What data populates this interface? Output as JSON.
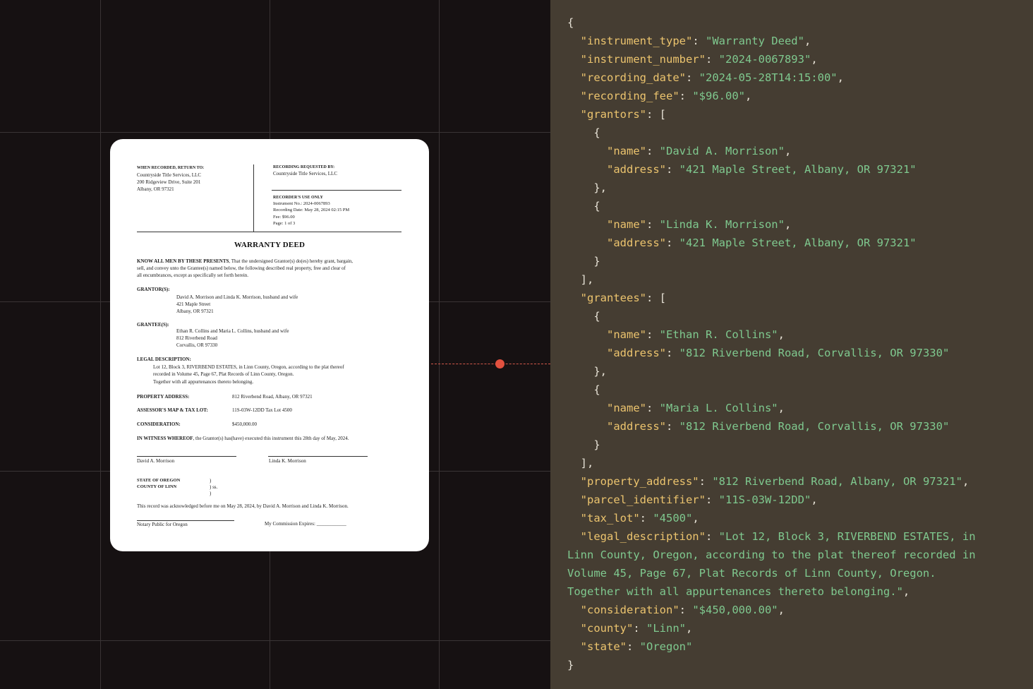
{
  "document": {
    "return_to_heading": "WHEN RECORDED, RETURN TO:",
    "return_to_lines": [
      "Countryside Title Services, LLC",
      "200 Ridgeview Drive, Suite 201",
      "Albany, OR 97321"
    ],
    "requested_by_heading": "RECORDING REQUESTED BY:",
    "requested_by_name": "Countryside Title Services, LLC",
    "recorder_heading": "RECORDER'S USE ONLY",
    "recorder_lines": [
      "Instrument No.:  2024-0067893",
      "Recording Date:  May 28, 2024  02:15 PM",
      "Fee:  $96.00",
      "Page:  1 of 3"
    ],
    "title": "WARRANTY DEED",
    "intro_lead": "KNOW ALL MEN BY THESE PRESENTS",
    "intro_lines": [
      ", That the undersigned Grantor(s) do(es) hereby grant, bargain,",
      "sell, and convey unto the Grantee(s) named below, the following described real property, free and clear of",
      "all encumbrances, except as specifically set forth herein."
    ],
    "grantor_heading": "GRANTOR(S):",
    "grantor_lines": [
      "David A. Morrison and Linda K. Morrison, husband and wife",
      "421 Maple Street",
      "Albany, OR 97321"
    ],
    "grantee_heading": "GRANTEE(S):",
    "grantee_lines": [
      "Ethan R. Collins and Maria L. Collins, husband and wife",
      "812 Riverbend Road",
      "Corvallis, OR 97330"
    ],
    "legal_heading": "LEGAL DESCRIPTION:",
    "legal_lines": [
      "Lot 12, Block 3, RIVERBEND ESTATES, in Linn County, Oregon, according to the plat thereof",
      "recorded in Volume 45, Page 67, Plat Records of Linn County, Oregon.",
      "Together with all appurtenances thereto belonging."
    ],
    "property_label": "PROPERTY ADDRESS:",
    "property_value": "812 Riverbend Road, Albany, OR 97321",
    "assessor_label": "ASSESSOR'S MAP & TAX LOT:",
    "assessor_value": "11S-03W-12DD   Tax Lot 4500",
    "consideration_label": "CONSIDERATION:",
    "consideration_value": "$450,000.00",
    "witness_lead": "IN WITNESS WHEREOF",
    "witness_text": ", the Grantor(s) has(have) executed this instrument this 28th day of May, 2024.",
    "signer_1": "David A. Morrison",
    "signer_2": "Linda K. Morrison",
    "state_line": "STATE OF OREGON",
    "county_line": "COUNTY OF LINN",
    "paren_1": ")",
    "paren_2": ")  ss.",
    "paren_3": ")",
    "ack_text": "This record was acknowledged before me on May 28, 2024, by David A. Morrison and Linda K. Morrison.",
    "notary_label": "Notary Public for Oregon",
    "commission_label": "My Commission Expires: ____________"
  },
  "json_panel": {
    "lines": [
      [
        [
          "p",
          "{"
        ]
      ],
      [
        [
          "p",
          "  "
        ],
        [
          "k",
          "\"instrument_type\""
        ],
        [
          "p",
          ": "
        ],
        [
          "s",
          "\"Warranty Deed\""
        ],
        [
          "p",
          ","
        ]
      ],
      [
        [
          "p",
          "  "
        ],
        [
          "k",
          "\"instrument_number\""
        ],
        [
          "p",
          ": "
        ],
        [
          "s",
          "\"2024-0067893\""
        ],
        [
          "p",
          ","
        ]
      ],
      [
        [
          "p",
          "  "
        ],
        [
          "k",
          "\"recording_date\""
        ],
        [
          "p",
          ": "
        ],
        [
          "s",
          "\"2024-05-28T14:15:00\""
        ],
        [
          "p",
          ","
        ]
      ],
      [
        [
          "p",
          "  "
        ],
        [
          "k",
          "\"recording_fee\""
        ],
        [
          "p",
          ": "
        ],
        [
          "s",
          "\"$96.00\""
        ],
        [
          "p",
          ","
        ]
      ],
      [
        [
          "p",
          "  "
        ],
        [
          "k",
          "\"grantors\""
        ],
        [
          "p",
          ": ["
        ]
      ],
      [
        [
          "p",
          "    {"
        ]
      ],
      [
        [
          "p",
          "      "
        ],
        [
          "k",
          "\"name\""
        ],
        [
          "p",
          ": "
        ],
        [
          "s",
          "\"David A. Morrison\""
        ],
        [
          "p",
          ","
        ]
      ],
      [
        [
          "p",
          "      "
        ],
        [
          "k",
          "\"address\""
        ],
        [
          "p",
          ": "
        ],
        [
          "s",
          "\"421 Maple Street, Albany, OR 97321\""
        ]
      ],
      [
        [
          "p",
          "    },"
        ]
      ],
      [
        [
          "p",
          "    {"
        ]
      ],
      [
        [
          "p",
          "      "
        ],
        [
          "k",
          "\"name\""
        ],
        [
          "p",
          ": "
        ],
        [
          "s",
          "\"Linda K. Morrison\""
        ],
        [
          "p",
          ","
        ]
      ],
      [
        [
          "p",
          "      "
        ],
        [
          "k",
          "\"address\""
        ],
        [
          "p",
          ": "
        ],
        [
          "s",
          "\"421 Maple Street, Albany, OR 97321\""
        ]
      ],
      [
        [
          "p",
          "    }"
        ]
      ],
      [
        [
          "p",
          "  ],"
        ]
      ],
      [
        [
          "p",
          "  "
        ],
        [
          "k",
          "\"grantees\""
        ],
        [
          "p",
          ": ["
        ]
      ],
      [
        [
          "p",
          "    {"
        ]
      ],
      [
        [
          "p",
          "      "
        ],
        [
          "k",
          "\"name\""
        ],
        [
          "p",
          ": "
        ],
        [
          "s",
          "\"Ethan R. Collins\""
        ],
        [
          "p",
          ","
        ]
      ],
      [
        [
          "p",
          "      "
        ],
        [
          "k",
          "\"address\""
        ],
        [
          "p",
          ": "
        ],
        [
          "s",
          "\"812 Riverbend Road, Corvallis, OR 97330\""
        ]
      ],
      [
        [
          "p",
          "    },"
        ]
      ],
      [
        [
          "p",
          "    {"
        ]
      ],
      [
        [
          "p",
          "      "
        ],
        [
          "k",
          "\"name\""
        ],
        [
          "p",
          ": "
        ],
        [
          "s",
          "\"Maria L. Collins\""
        ],
        [
          "p",
          ","
        ]
      ],
      [
        [
          "p",
          "      "
        ],
        [
          "k",
          "\"address\""
        ],
        [
          "p",
          ": "
        ],
        [
          "s",
          "\"812 Riverbend Road, Corvallis, OR 97330\""
        ]
      ],
      [
        [
          "p",
          "    }"
        ]
      ],
      [
        [
          "p",
          "  ],"
        ]
      ],
      [
        [
          "p",
          "  "
        ],
        [
          "k",
          "\"property_address\""
        ],
        [
          "p",
          ": "
        ],
        [
          "s",
          "\"812 Riverbend Road, Albany, OR 97321\""
        ],
        [
          "p",
          ","
        ]
      ],
      [
        [
          "p",
          "  "
        ],
        [
          "k",
          "\"parcel_identifier\""
        ],
        [
          "p",
          ": "
        ],
        [
          "s",
          "\"11S-03W-12DD\""
        ],
        [
          "p",
          ","
        ]
      ],
      [
        [
          "p",
          "  "
        ],
        [
          "k",
          "\"tax_lot\""
        ],
        [
          "p",
          ": "
        ],
        [
          "s",
          "\"4500\""
        ],
        [
          "p",
          ","
        ]
      ],
      [
        [
          "p",
          "  "
        ],
        [
          "k",
          "\"legal_description\""
        ],
        [
          "p",
          ": "
        ],
        [
          "s",
          "\"Lot 12, Block 3, RIVERBEND ESTATES, in"
        ]
      ],
      [
        [
          "s",
          "Linn County, Oregon, according to the plat thereof recorded in"
        ]
      ],
      [
        [
          "s",
          "Volume 45, Page 67, Plat Records of Linn County, Oregon."
        ]
      ],
      [
        [
          "s",
          "Together with all appurtenances thereto belonging.\""
        ],
        [
          "p",
          ","
        ]
      ],
      [
        [
          "p",
          "  "
        ],
        [
          "k",
          "\"consideration\""
        ],
        [
          "p",
          ": "
        ],
        [
          "s",
          "\"$450,000.00\""
        ],
        [
          "p",
          ","
        ]
      ],
      [
        [
          "p",
          "  "
        ],
        [
          "k",
          "\"county\""
        ],
        [
          "p",
          ": "
        ],
        [
          "s",
          "\"Linn\""
        ],
        [
          "p",
          ","
        ]
      ],
      [
        [
          "p",
          "  "
        ],
        [
          "k",
          "\"state\""
        ],
        [
          "p",
          ": "
        ],
        [
          "s",
          "\"Oregon\""
        ]
      ],
      [
        [
          "p",
          "}"
        ]
      ]
    ]
  }
}
